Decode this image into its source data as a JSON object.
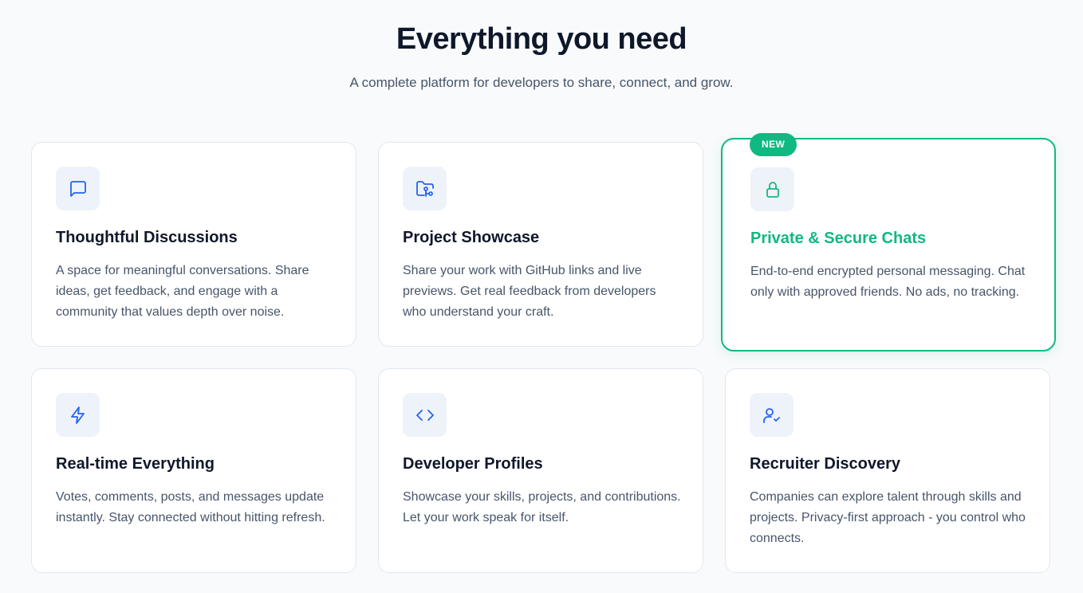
{
  "header": {
    "title": "Everything you need",
    "subtitle": "A complete platform for developers to share, connect, and grow."
  },
  "colors": {
    "accent": "#10b981",
    "icon": "#2563eb",
    "heading": "#0f172a",
    "body_text": "#475569"
  },
  "features": [
    {
      "icon": "message-square-icon",
      "title": "Thoughtful Discussions",
      "description": "A space for meaningful conversations. Share ideas, get feedback, and engage with a community that values depth over noise."
    },
    {
      "icon": "folder-git-icon",
      "title": "Project Showcase",
      "description": "Share your work with GitHub links and live previews. Get real feedback from developers who understand your craft."
    },
    {
      "icon": "lock-icon",
      "title": "Private & Secure Chats",
      "description": "End-to-end encrypted personal messaging. Chat only with approved friends. No ads, no tracking.",
      "badge": "NEW"
    },
    {
      "icon": "zap-icon",
      "title": "Real-time Everything",
      "description": "Votes, comments, posts, and messages update instantly. Stay connected without hitting refresh."
    },
    {
      "icon": "code-icon",
      "title": "Developer Profiles",
      "description": "Showcase your skills, projects, and contributions. Let your work speak for itself."
    },
    {
      "icon": "user-check-icon",
      "title": "Recruiter Discovery",
      "description": "Companies can explore talent through skills and projects. Privacy-first approach - you control who connects."
    }
  ]
}
